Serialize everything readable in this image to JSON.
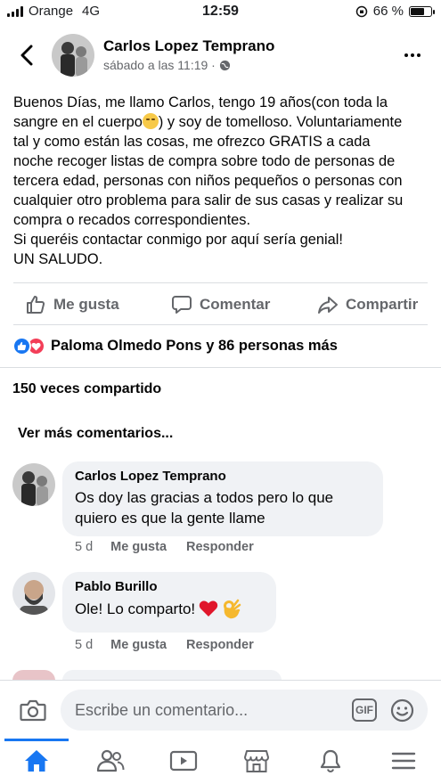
{
  "status_bar": {
    "carrier": "Orange",
    "network": "4G",
    "time": "12:59",
    "battery": "66 %",
    "battery_level": 0.66
  },
  "post": {
    "author": "Carlos Lopez Temprano",
    "timestamp": "sábado a las 11:19 ·",
    "privacy_icon": "globe-icon",
    "text_lines": [
      "Buenos Días, me llamo Carlos, tengo 19 años(con toda la",
      "sangre en el cuerpo",
      ") y soy de tomelloso. Voluntariamente",
      "tal y como están las cosas, me ofrezco GRATIS a cada",
      "noche recoger listas de compra sobre todo de personas de",
      "tercera edad, personas con niños pequeños o personas con",
      "cualquier otro problema para salir de sus casas y realizar su",
      "compra o recados correspondientes.",
      "Si queréis contactar conmigo por aquí sería genial!",
      "UN SALUDO."
    ]
  },
  "actions": {
    "like": "Me gusta",
    "comment": "Comentar",
    "share": "Compartir"
  },
  "reactions": {
    "summary": "Paloma Olmedo Pons y 86 personas más",
    "icons": [
      "like-icon",
      "love-icon"
    ]
  },
  "shares": "150 veces compartido",
  "more_comments": "Ver más comentarios...",
  "comments": [
    {
      "author": "Carlos Lopez Temprano",
      "text_line1": "Os doy las gracias a todos pero lo que",
      "text_line2": "quiero es que la gente llame",
      "time": "5 d",
      "like": "Me gusta",
      "reply": "Responder"
    },
    {
      "author": "Pablo Burillo",
      "text": "Ole! Lo comparto!",
      "emojis": [
        "red-heart",
        "ok-hand"
      ],
      "time": "5 d",
      "like": "Me gusta",
      "reply": "Responder"
    }
  ],
  "composer": {
    "placeholder": "Escribe un comentario...",
    "gif_label": "GIF"
  },
  "nav": {
    "items": [
      "home-icon",
      "friends-icon",
      "watch-icon",
      "marketplace-icon",
      "notifications-icon",
      "menu-icon"
    ],
    "accent": "#1877f2"
  }
}
